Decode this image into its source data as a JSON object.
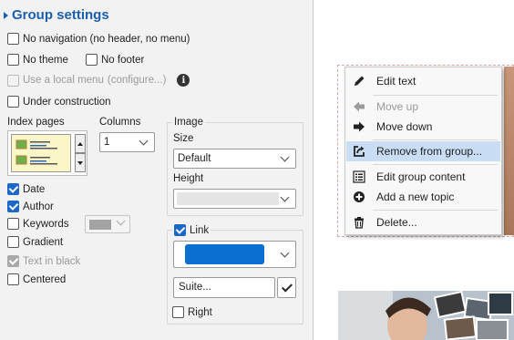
{
  "panel": {
    "title": "Group settings",
    "checkboxes": {
      "no_navigation": {
        "label": "No navigation (no header, no menu)",
        "checked": false
      },
      "no_theme": {
        "label": "No theme",
        "checked": false
      },
      "no_footer": {
        "label": "No footer",
        "checked": false
      },
      "local_menu": {
        "label": "Use a local menu",
        "link": "(configure...)",
        "checked": false,
        "disabled": true
      },
      "under_construction": {
        "label": "Under construction",
        "checked": false
      }
    },
    "index_pages_label": "Index pages",
    "columns": {
      "label": "Columns",
      "value": "1"
    },
    "options": {
      "date": {
        "label": "Date",
        "checked": true
      },
      "author": {
        "label": "Author",
        "checked": true
      },
      "keywords": {
        "label": "Keywords",
        "checked": false
      },
      "gradient": {
        "label": "Gradient",
        "checked": false
      },
      "text_in_black": {
        "label": "Text in black",
        "checked": true,
        "disabled": true
      },
      "centered": {
        "label": "Centered",
        "checked": false
      }
    },
    "image": {
      "label": "Image",
      "size_label": "Size",
      "size_value": "Default",
      "height_label": "Height",
      "height_value": ""
    },
    "link": {
      "label": "Link",
      "checked": true,
      "color": "#0a6fd1",
      "suite_value": "Suite...",
      "right_label": "Right",
      "right_checked": false
    }
  },
  "context_menu": {
    "items": [
      {
        "label": "Edit text",
        "icon": "pencil-icon",
        "disabled": false
      },
      {
        "label": "Move up",
        "icon": "arrow-left-icon",
        "disabled": true
      },
      {
        "label": "Move down",
        "icon": "arrow-right-icon",
        "disabled": false
      },
      {
        "label": "Remove from group...",
        "icon": "export-icon",
        "disabled": false,
        "highlighted": true
      },
      {
        "label": "Edit group content",
        "icon": "list-icon",
        "disabled": false
      },
      {
        "label": "Add a new topic",
        "icon": "plus-circle-icon",
        "disabled": false
      },
      {
        "label": "Delete...",
        "icon": "trash-icon",
        "disabled": false
      }
    ]
  },
  "colors": {
    "accent": "#1b5fb0",
    "checkbox_checked": "#1c68c9",
    "menu_highlight": "#c9def5"
  }
}
